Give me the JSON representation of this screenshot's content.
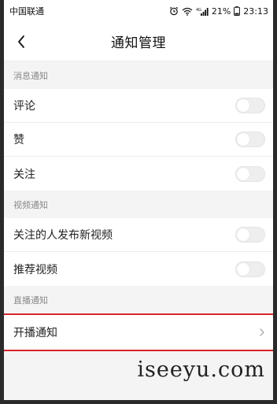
{
  "status_bar": {
    "carrier": "中国联通",
    "battery": "21%",
    "time": "23:13",
    "icons": [
      "alarm-icon",
      "wifi-icon",
      "signal-4g-icon"
    ]
  },
  "nav": {
    "title": "通知管理",
    "back_icon": "back-arrow-icon"
  },
  "sections": {
    "message": {
      "header": "消息通知",
      "items": [
        {
          "label": "评论",
          "enabled": false
        },
        {
          "label": "赞",
          "enabled": false
        },
        {
          "label": "关注",
          "enabled": false
        }
      ]
    },
    "video": {
      "header": "视频通知",
      "items": [
        {
          "label": "关注的人发布新视频",
          "enabled": false
        },
        {
          "label": "推荐视频",
          "enabled": false
        }
      ]
    },
    "live": {
      "header": "直播通知",
      "items": [
        {
          "label": "开播通知",
          "icon": "chevron-right-icon"
        }
      ]
    }
  },
  "colors": {
    "highlight_border": "#d9232d",
    "toggle_off": "#eeeeee"
  },
  "watermark": "iseeyu.com"
}
